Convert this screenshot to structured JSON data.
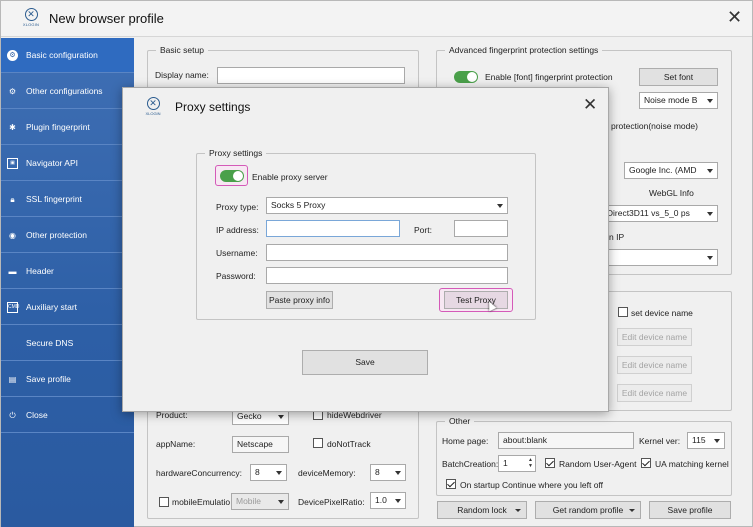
{
  "window": {
    "title": "New browser profile",
    "logo_text": "XLOGIN"
  },
  "sidebar": {
    "items": [
      {
        "label": "Basic configuration",
        "icon": "gear-icon"
      },
      {
        "label": "Other configurations",
        "icon": "settings-icon"
      },
      {
        "label": "Plugin fingerprint",
        "icon": "plugin-icon"
      },
      {
        "label": "Navigator API",
        "icon": "navigator-icon"
      },
      {
        "label": "SSL fingerprint",
        "icon": "lock-icon"
      },
      {
        "label": "Other protection",
        "icon": "shield-icon"
      },
      {
        "label": "Header",
        "icon": "header-icon"
      },
      {
        "label": "Auxiliary start",
        "icon": "cmd-icon"
      },
      {
        "label": "Secure DNS",
        "icon": ""
      },
      {
        "label": "Save profile",
        "icon": "save-icon"
      },
      {
        "label": "Close",
        "icon": "close-icon"
      }
    ]
  },
  "basic_setup": {
    "legend": "Basic setup",
    "display_name_label": "Display name:",
    "display_name_value": ""
  },
  "advanced": {
    "legend": "Advanced fingerprint protection settings",
    "font_toggle_label": "Enable [font] fingerprint protection",
    "set_font_button": "Set font",
    "noise_mode_value": "Noise mode B",
    "protection_noise_label": "protection(noise mode)",
    "webgl_vendor_value": "Google Inc. (AMD",
    "webgl_info_label": "WebGL Info",
    "webgl_renderer_value": "cs Direct3D11 vs_5_0 ps",
    "ip_label": "n IP",
    "set_device_name_label": "set device name",
    "edit_device_name_button": "Edit device name"
  },
  "lower_left": {
    "product_label": "Product:",
    "product_value": "Gecko",
    "hide_webdriver_label": "hideWebdriver",
    "appname_label": "appName:",
    "appname_value": "Netscape",
    "do_not_track_label": "doNotTrack",
    "hw_concurrency_label": "hardwareConcurrency:",
    "hw_concurrency_value": "8",
    "device_memory_label": "deviceMemory:",
    "device_memory_value": "8",
    "mobile_emulation_label": "mobileEmulatio",
    "mobile_value": "Mobile",
    "device_pixel_ratio_label": "DevicePixelRatio:",
    "device_pixel_ratio_value": "1.0"
  },
  "other": {
    "legend": "Other",
    "home_page_label": "Home page:",
    "home_page_value": "about:blank",
    "kernel_ver_label": "Kernel ver:",
    "kernel_ver_value": "115",
    "batch_creation_label": "BatchCreation:",
    "batch_creation_value": "1",
    "random_ua_label": "Random User-Agent",
    "ua_matching_label": "UA matching kernel",
    "startup_continue_label": "On startup Continue where you left off"
  },
  "footer": {
    "random_lock_button": "Random lock",
    "get_random_profile_button": "Get random profile",
    "save_profile_button": "Save profile"
  },
  "proxy_modal": {
    "title": "Proxy settings",
    "logo_text": "XLOGIN",
    "group_legend": "Proxy settings",
    "enable_proxy_label": "Enable proxy server",
    "proxy_type_label": "Proxy type:",
    "proxy_type_value": "Socks 5 Proxy",
    "ip_address_label": "IP address:",
    "ip_address_value": "",
    "port_label": "Port:",
    "port_value": "",
    "username_label": "Username:",
    "username_value": "",
    "password_label": "Password:",
    "password_value": "",
    "paste_proxy_button": "Paste proxy info",
    "test_proxy_button": "Test Proxy",
    "save_button": "Save"
  },
  "colors": {
    "sidebar_bg": "#2d5fa6",
    "toggle_on": "#4aa04a",
    "highlight": "#d45ab8"
  }
}
